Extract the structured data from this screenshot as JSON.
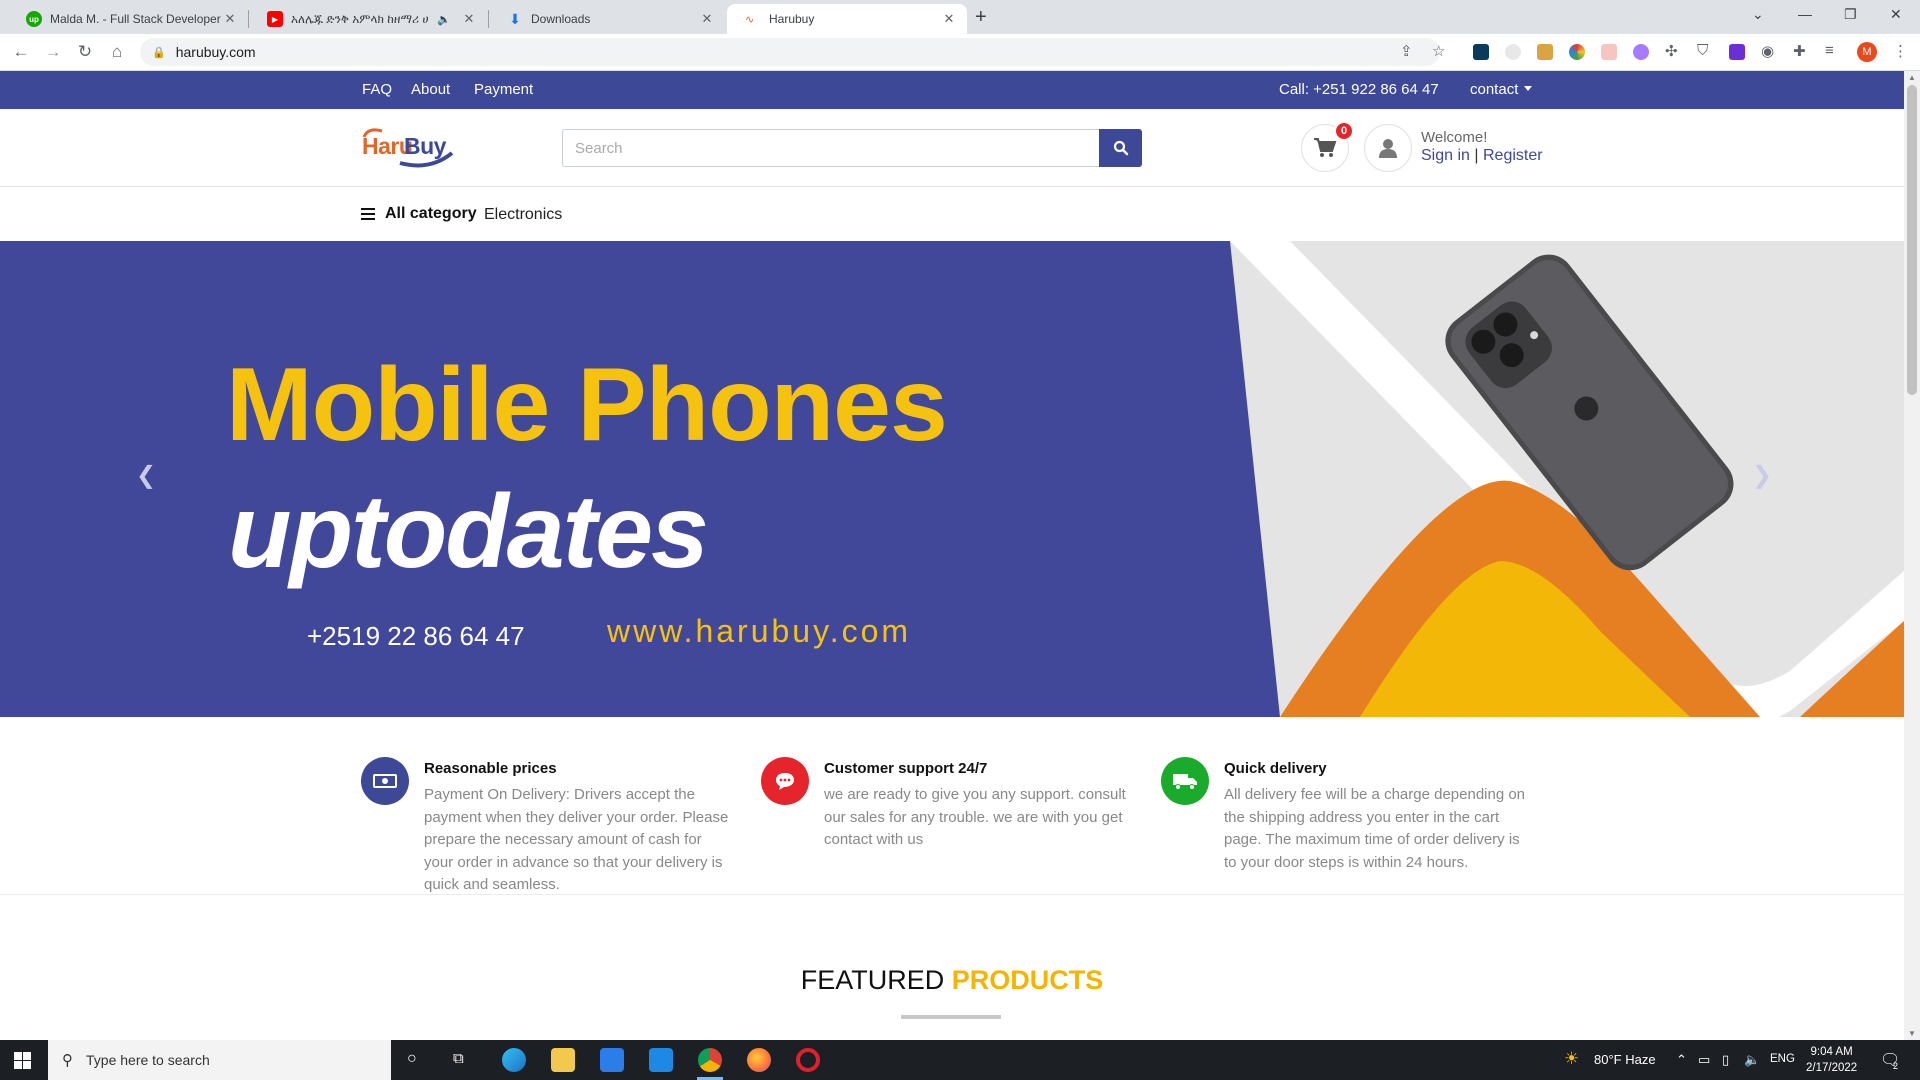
{
  "browser": {
    "tabs": [
      {
        "title": "Malda M. - Full Stack Developer |",
        "favicon": "upwork-icon"
      },
      {
        "title": "አለሌጁ ድንቅ አምላክ ከዘማሪ ሀ",
        "favicon": "youtube-icon"
      },
      {
        "title": "Downloads",
        "favicon": "download-icon"
      },
      {
        "title": "Harubuy",
        "favicon": "harubuy-icon"
      }
    ],
    "url": "harubuy.com",
    "profile_initial": "M"
  },
  "topbar": {
    "links": [
      "FAQ",
      "About",
      "Payment"
    ],
    "call": "Call: +251 922 86 64 47",
    "contact": "contact"
  },
  "header": {
    "logo_part1": "Haru",
    "logo_part2": "Buy",
    "search_placeholder": "Search",
    "cart_count": "0",
    "welcome": "Welcome!",
    "sign_in": "Sign in",
    "separator": "|",
    "register": "Register"
  },
  "categories": {
    "all_label": "All category",
    "items": [
      "Electronics"
    ]
  },
  "hero": {
    "line1": "Mobile Phones",
    "line2": "uptodates",
    "phone": "+2519 22 86 64 47",
    "url": "www.harubuy.com",
    "colors": {
      "background": "#41489a",
      "yellow": "#f5c20f",
      "orange": "#e67e22"
    }
  },
  "features": [
    {
      "title": "Reasonable prices",
      "text": "Payment On Delivery: Drivers accept the payment when they deliver your order. Please prepare the necessary amount of cash for your order in advance so that your delivery is quick and seamless.",
      "icon": "money-icon",
      "color": "#3d4897"
    },
    {
      "title": "Customer support 24/7",
      "text": "we are ready to give you any support. consult our sales for any trouble. we are with you get contact with us",
      "icon": "chat-icon",
      "color": "#e5242b"
    },
    {
      "title": "Quick delivery",
      "text": "All delivery fee will be a charge depending on the shipping address you enter in the cart page. The maximum time of order delivery is to your door steps is within 24 hours.",
      "icon": "truck-icon",
      "color": "#1aab2d"
    }
  ],
  "featured": {
    "word1": "FEATURED",
    "word2": "PRODUCTS"
  },
  "taskbar": {
    "search_placeholder": "Type here to search",
    "weather": "80°F  Haze",
    "lang": "ENG",
    "time": "9:04 AM",
    "date": "2/17/2022",
    "notif_count": "2"
  }
}
